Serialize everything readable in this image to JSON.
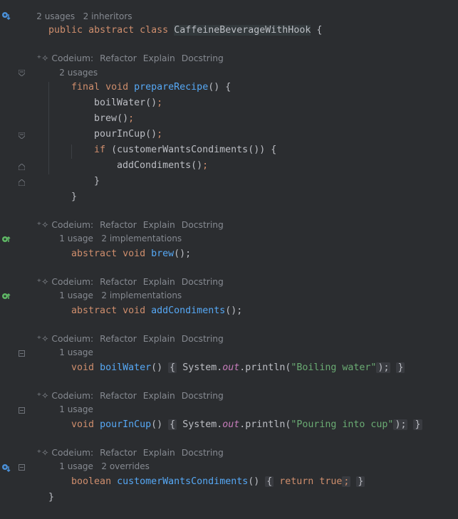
{
  "class_header": {
    "usages": "2 usages",
    "inheritors": "2 inheritors",
    "declaration": [
      "public",
      "abstract",
      "class",
      "CaffeineBeverageWithHook",
      "{"
    ]
  },
  "codeium": {
    "label": "Codeium:",
    "actions": [
      "Refactor",
      "Explain",
      "Docstring"
    ]
  },
  "methods": {
    "prepareRecipe": {
      "meta": "2 usages",
      "signature": [
        "final",
        "void",
        "prepareRecipe",
        "() {"
      ],
      "body": [
        "boilWater",
        "brew",
        "pourInCup"
      ],
      "if_kw": "if",
      "condition": "(customerWantsCondiments()) {",
      "inner_call": "addCondiments",
      "close_inner": "}",
      "close": "}"
    },
    "brew": {
      "meta_usage": "1 usage",
      "meta_impl": "2 implementations",
      "signature": [
        "abstract",
        "void",
        "brew",
        "();"
      ]
    },
    "addCondiments": {
      "meta_usage": "1 usage",
      "meta_impl": "2 implementations",
      "signature": [
        "abstract",
        "void",
        "addCondiments",
        "();"
      ]
    },
    "boilWater": {
      "meta_usage": "1 usage",
      "signature": [
        "void",
        "boilWater",
        "()"
      ],
      "body_prefix": "System.",
      "body_field": "out",
      "body_call": ".println(",
      "body_string": "\"Boiling water\"",
      "body_end": ");"
    },
    "pourInCup": {
      "meta_usage": "1 usage",
      "signature": [
        "void",
        "pourInCup",
        "()"
      ],
      "body_prefix": "System.",
      "body_field": "out",
      "body_call": ".println(",
      "body_string": "\"Pouring into cup\"",
      "body_end": ");"
    },
    "customerWantsCondiments": {
      "meta_usage": "1 usage",
      "meta_overrides": "2 overrides",
      "signature": [
        "boolean",
        "customerWantsCondiments",
        "()"
      ],
      "body_kw": "return",
      "body_val": "true",
      "body_end": ";"
    }
  },
  "closing_brace": "}",
  "colors": {
    "background": "#2b2d30",
    "keyword": "#cf8e6d",
    "function": "#56a8f5",
    "string": "#6aab73",
    "field": "#c77dbb",
    "text": "#bcbec4",
    "meta": "#868a91",
    "gutter_icon_blue": "#4a90d9",
    "gutter_icon_green": "#5fb865"
  }
}
